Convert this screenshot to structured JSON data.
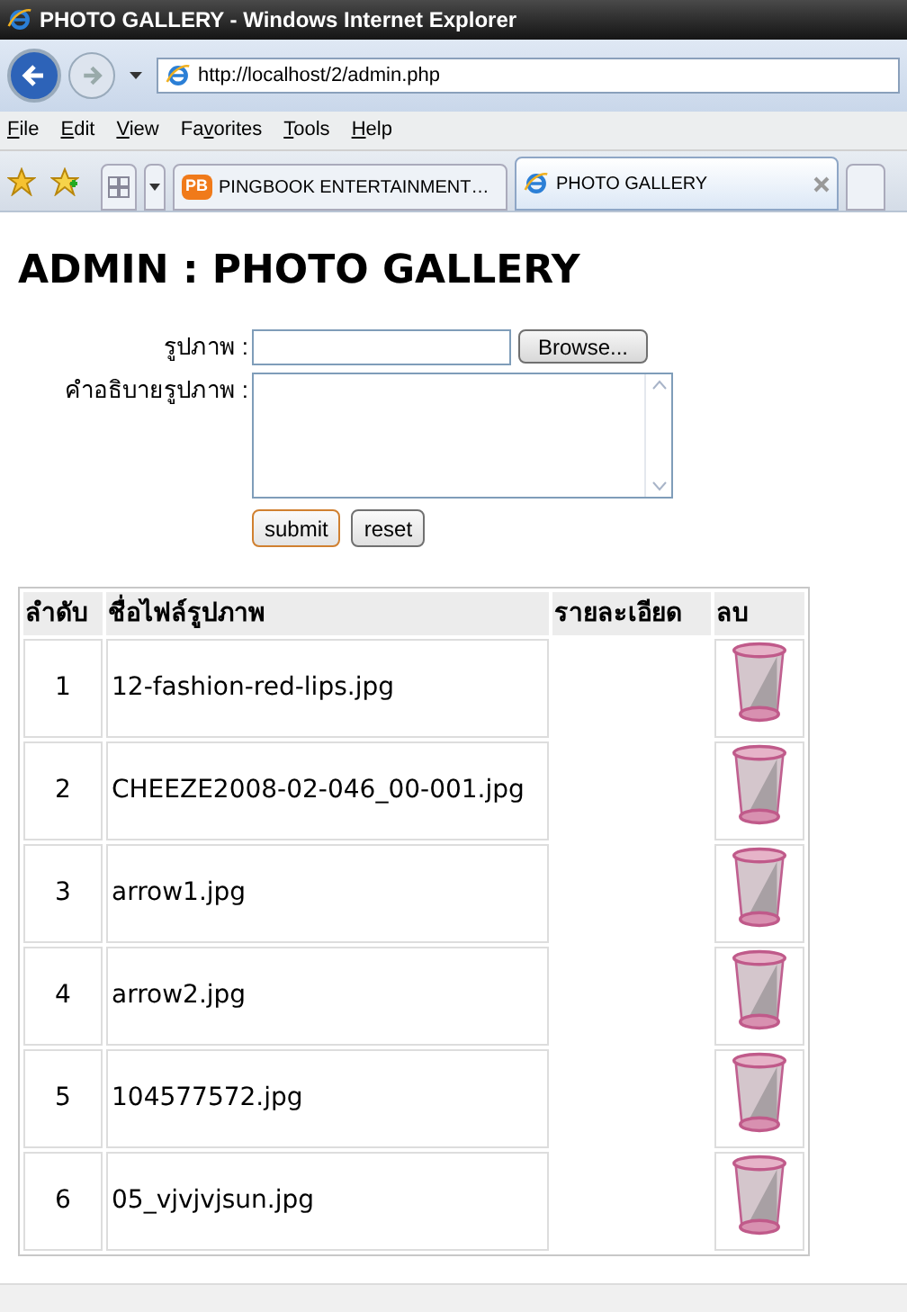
{
  "window": {
    "title": "PHOTO GALLERY - Windows Internet Explorer"
  },
  "address_bar": {
    "url": "http://localhost/2/admin.php"
  },
  "menu": [
    {
      "access_key": "F",
      "rest": "ile"
    },
    {
      "access_key": "E",
      "rest": "dit"
    },
    {
      "access_key": "V",
      "rest": "iew"
    },
    {
      "lead": "Fa",
      "access_key": "v",
      "rest": "orites"
    },
    {
      "access_key": "T",
      "rest": "ools"
    },
    {
      "access_key": "H",
      "rest": "elp"
    }
  ],
  "tabs": [
    {
      "label": "PINGBOOK ENTERTAINMENT…",
      "badge": "PB",
      "selected": false
    },
    {
      "label": "PHOTO GALLERY",
      "selected": true
    }
  ],
  "page": {
    "heading": "ADMIN : PHOTO GALLERY",
    "form": {
      "image_label": "รูปภาพ :",
      "browse_button": "Browse...",
      "description_label": "คำอธิบายรูปภาพ :",
      "submit": "submit",
      "reset": "reset"
    },
    "table": {
      "columns": [
        "ลำดับ",
        "ชื่อไฟล์รูปภาพ",
        "รายละเอียด",
        "ลบ"
      ],
      "rows": [
        {
          "number": "1",
          "filename": "12-fashion-red-lips.jpg"
        },
        {
          "number": "2",
          "filename": "CHEEZE2008-02-046_00-001.jpg"
        },
        {
          "number": "3",
          "filename": "arrow1.jpg"
        },
        {
          "number": "4",
          "filename": "arrow2.jpg"
        },
        {
          "number": "5",
          "filename": "104577572.jpg"
        },
        {
          "number": "6",
          "filename": "05_vjvjvjsun.jpg"
        }
      ]
    }
  }
}
